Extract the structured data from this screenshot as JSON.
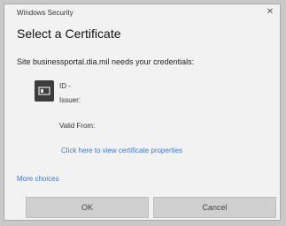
{
  "window": {
    "app_title": "Windows Security",
    "close_glyph": "✕"
  },
  "dialog": {
    "heading": "Select a Certificate",
    "message": "Site businessportal.dia.mil needs your credentials:"
  },
  "certificate": {
    "icon": "certificate-card-icon",
    "id_label": "ID -",
    "issuer_label": "Issuer:",
    "valid_from_label": "Valid From:",
    "properties_link": "Click here to view certificate properties"
  },
  "more_choices": "More choices",
  "buttons": {
    "ok": "OK",
    "cancel": "Cancel"
  },
  "colors": {
    "link": "#3a7bd5",
    "dialog_bg": "#f2f2f2",
    "button_bg": "#cfcfcf"
  }
}
